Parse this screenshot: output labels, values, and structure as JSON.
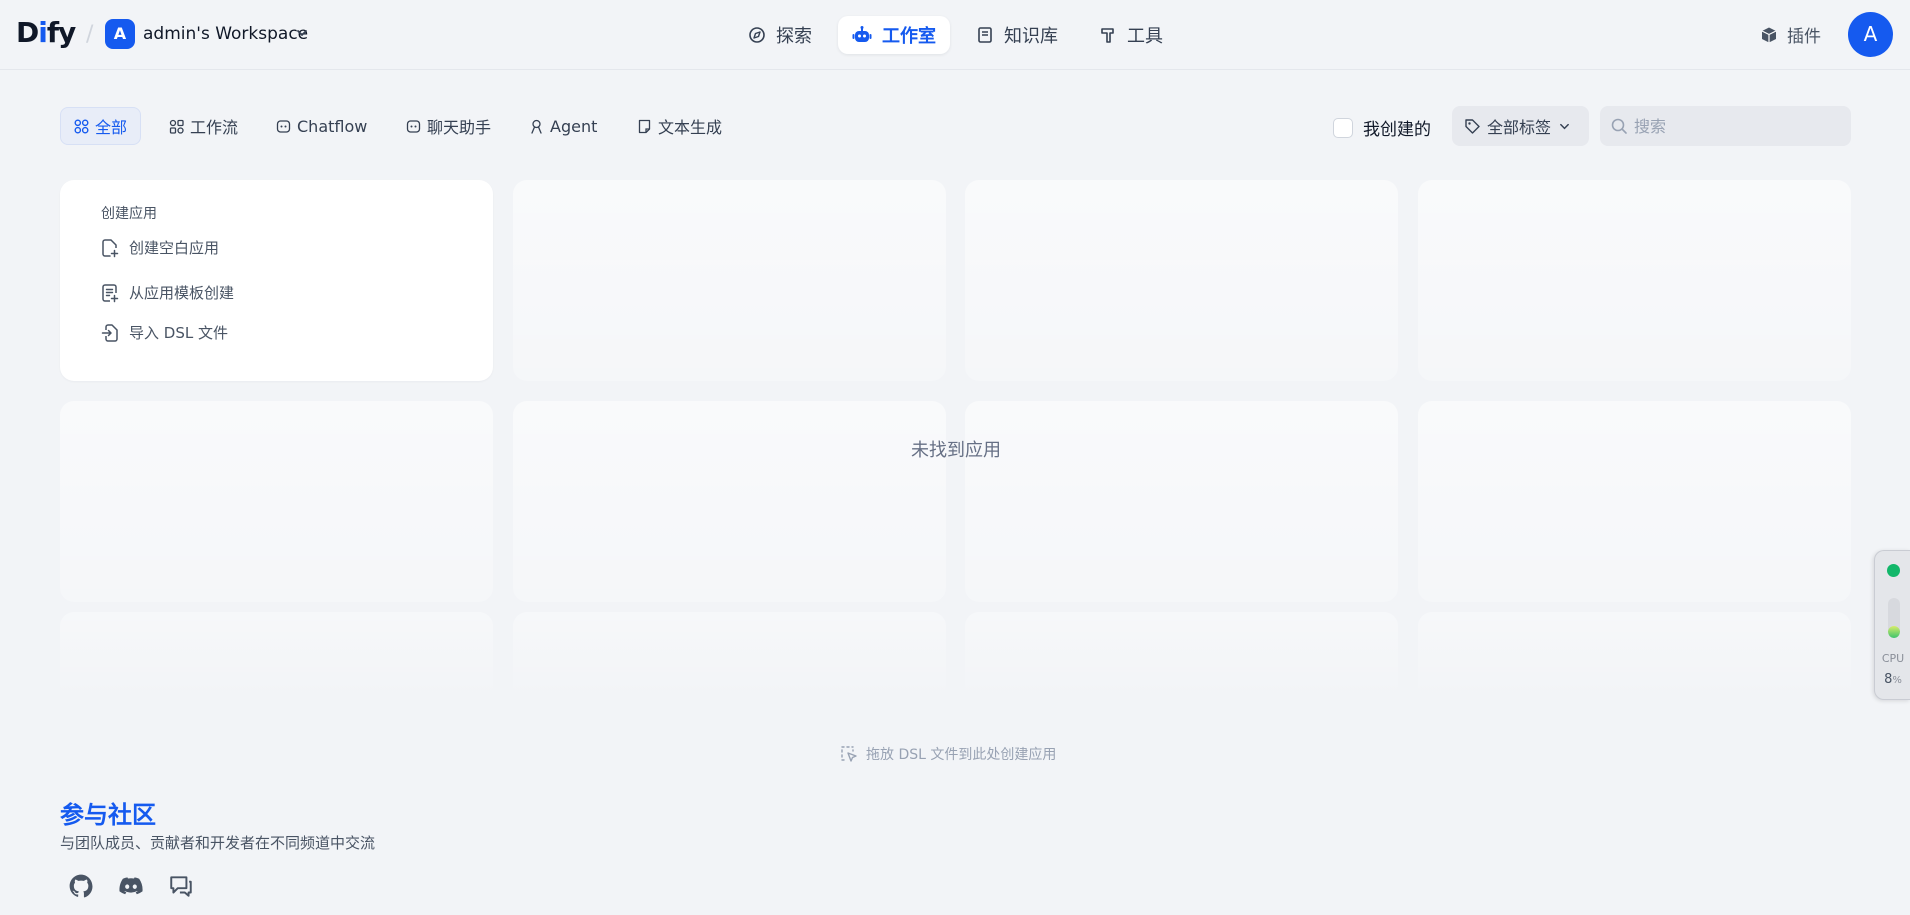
{
  "header": {
    "logo": {
      "d": "D",
      "i": "i",
      "fy": "fy"
    },
    "workspace": {
      "avatar_letter": "A",
      "name": "admin's Workspace"
    },
    "nav": [
      {
        "label": "探索",
        "icon": "compass-icon"
      },
      {
        "label": "工作室",
        "icon": "robot-icon",
        "active": true
      },
      {
        "label": "知识库",
        "icon": "book-icon"
      },
      {
        "label": "工具",
        "icon": "hammer-icon"
      }
    ],
    "plugins_label": "插件",
    "user_avatar_letter": "A"
  },
  "filters": {
    "tabs": [
      {
        "label": "全部",
        "icon": "grid-icon",
        "active": true
      },
      {
        "label": "工作流",
        "icon": "workflow-icon"
      },
      {
        "label": "Chatflow",
        "icon": "chatflow-icon"
      },
      {
        "label": "聊天助手",
        "icon": "chat-bot-icon"
      },
      {
        "label": "Agent",
        "icon": "agent-icon"
      },
      {
        "label": "文本生成",
        "icon": "file-text-icon"
      }
    ],
    "created_by_me_label": "我创建的",
    "created_by_me_checked": false,
    "tags_select_label": "全部标签",
    "search_placeholder": "搜索",
    "search_value": ""
  },
  "create_card": {
    "title": "创建应用",
    "items": [
      {
        "label": "创建空白应用",
        "icon": "file-plus-icon"
      },
      {
        "label": "从应用模板创建",
        "icon": "template-icon"
      },
      {
        "label": "导入 DSL 文件",
        "icon": "import-icon"
      }
    ]
  },
  "empty_message": "未找到应用",
  "drop_hint": "拖放 DSL 文件到此处创建应用",
  "community": {
    "title": "参与社区",
    "description": "与团队成员、贡献者和开发者在不同频道中交流",
    "links": [
      {
        "icon": "github-icon"
      },
      {
        "icon": "discord-icon"
      },
      {
        "icon": "forum-icon"
      }
    ]
  },
  "cpu_widget": {
    "label": "CPU",
    "value": "8",
    "unit": "%",
    "status_color": "#12b76a",
    "level_fraction": 0.3
  },
  "colors": {
    "accent": "#155aef",
    "background": "#f2f4f7"
  }
}
